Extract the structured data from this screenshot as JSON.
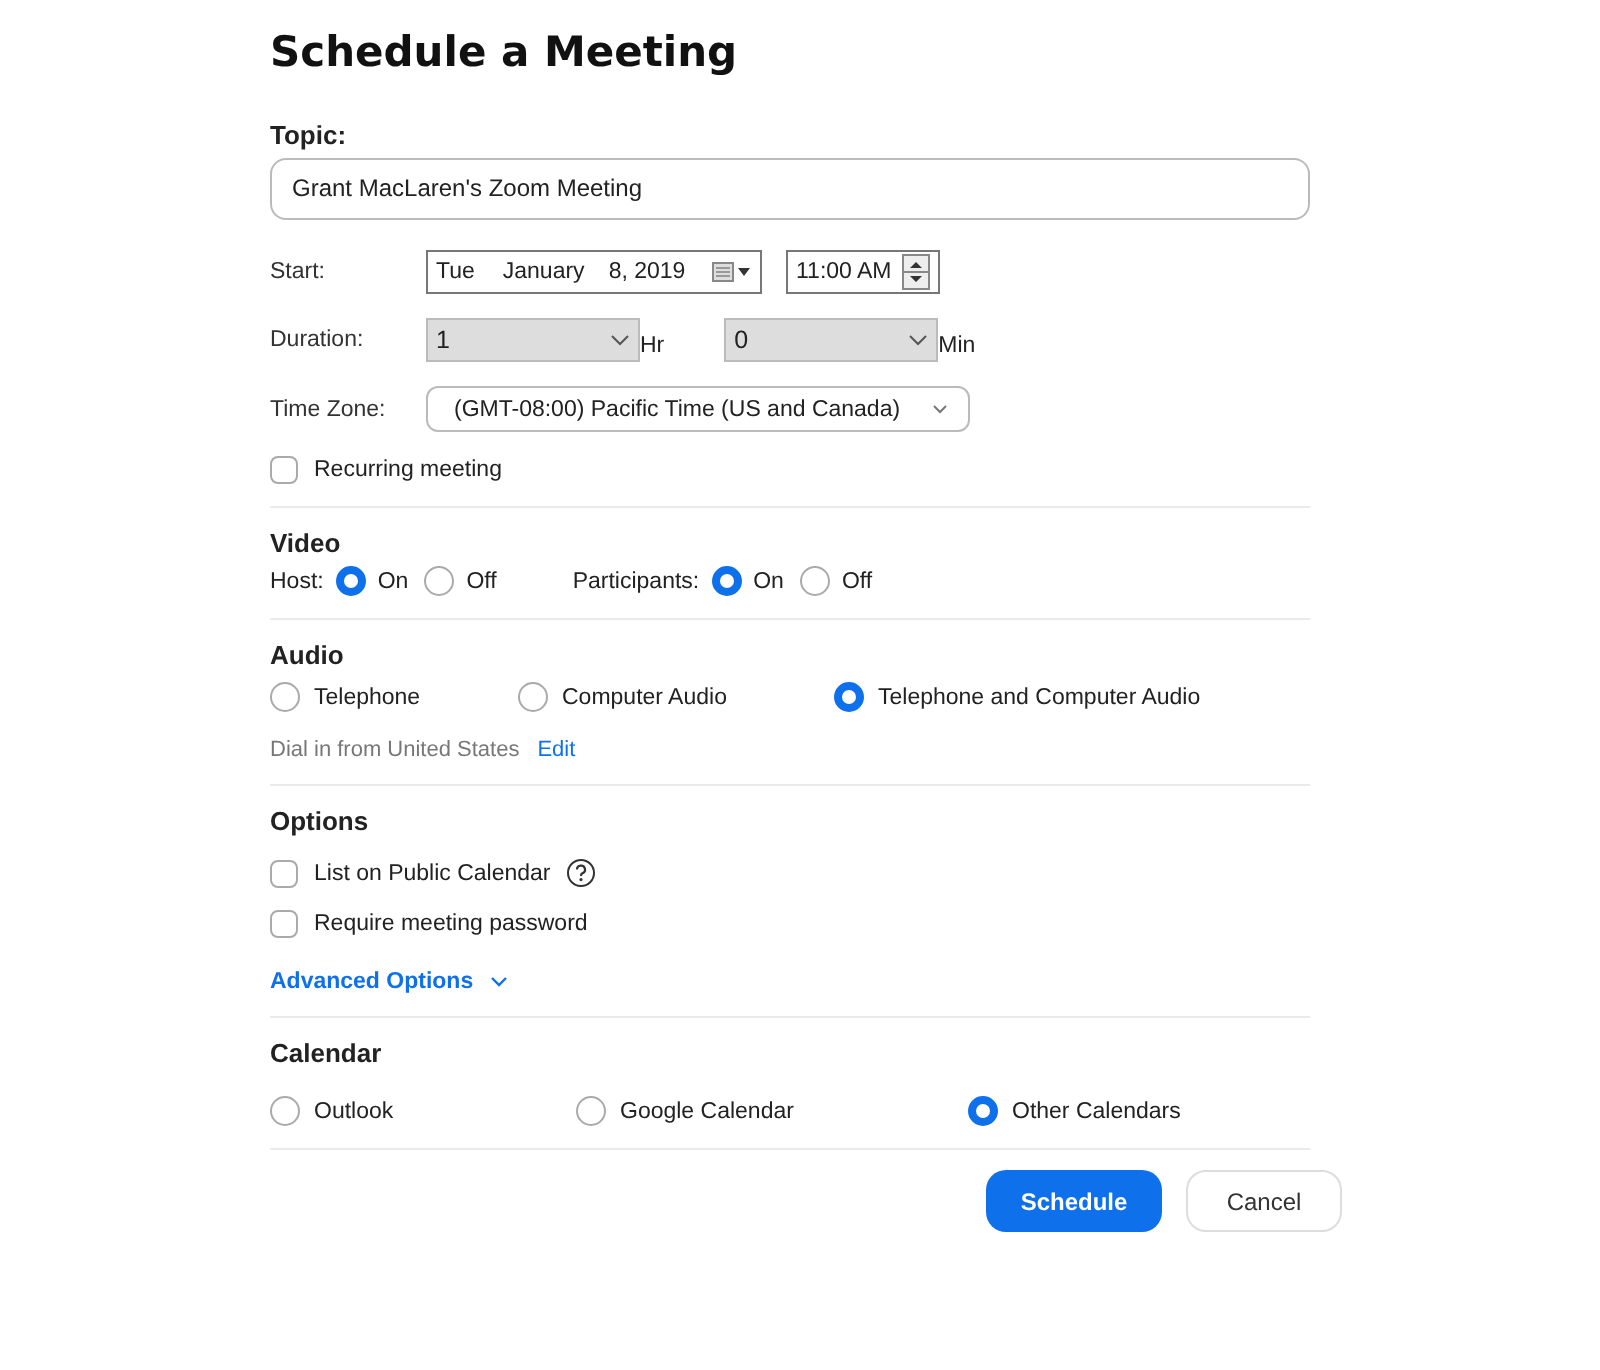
{
  "title": "Schedule a Meeting",
  "topic": {
    "label": "Topic:",
    "value": "Grant MacLaren's Zoom Meeting"
  },
  "start": {
    "label": "Start:",
    "weekday": "Tue",
    "month": "January",
    "day_year": "8, 2019",
    "time": "11:00 AM"
  },
  "duration": {
    "label": "Duration:",
    "hours": "1",
    "hours_unit": "Hr",
    "minutes": "0",
    "minutes_unit": "Min"
  },
  "time_zone": {
    "label": "Time Zone:",
    "value": "(GMT-08:00) Pacific Time (US and Canada)"
  },
  "recurring": {
    "label": "Recurring meeting",
    "checked": false
  },
  "video": {
    "heading": "Video",
    "groups": [
      {
        "label": "Host:",
        "options": [
          {
            "label": "On",
            "selected": true
          },
          {
            "label": "Off",
            "selected": false
          }
        ]
      },
      {
        "label": "Participants:",
        "options": [
          {
            "label": "On",
            "selected": true
          },
          {
            "label": "Off",
            "selected": false
          }
        ]
      }
    ]
  },
  "audio": {
    "heading": "Audio",
    "options": [
      {
        "label": "Telephone",
        "selected": false
      },
      {
        "label": "Computer Audio",
        "selected": false
      },
      {
        "label": "Telephone and Computer Audio",
        "selected": true
      }
    ],
    "dial_in": "Dial in from United States",
    "edit_link": "Edit"
  },
  "options": {
    "heading": "Options",
    "items": [
      {
        "label": "List on Public Calendar",
        "checked": false,
        "help": true
      },
      {
        "label": "Require meeting password",
        "checked": false,
        "help": false
      }
    ],
    "advanced": "Advanced Options"
  },
  "calendar": {
    "heading": "Calendar",
    "options": [
      {
        "label": "Outlook",
        "selected": false
      },
      {
        "label": "Google Calendar",
        "selected": false
      },
      {
        "label": "Other Calendars",
        "selected": true
      }
    ]
  },
  "buttons": {
    "primary": "Schedule",
    "secondary": "Cancel"
  }
}
